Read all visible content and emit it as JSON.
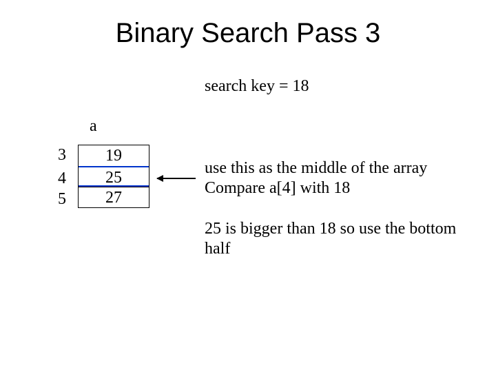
{
  "title": "Binary Search Pass 3",
  "search_key_text": "search key = 18",
  "array_label": "a",
  "indices": [
    "3",
    "4",
    "5"
  ],
  "values": [
    "19",
    "25",
    "27"
  ],
  "note_line1": "use this as the middle of the array",
  "note_line2": "Compare a[4] with 18",
  "note2": "25 is bigger than 18 so use the bottom half"
}
